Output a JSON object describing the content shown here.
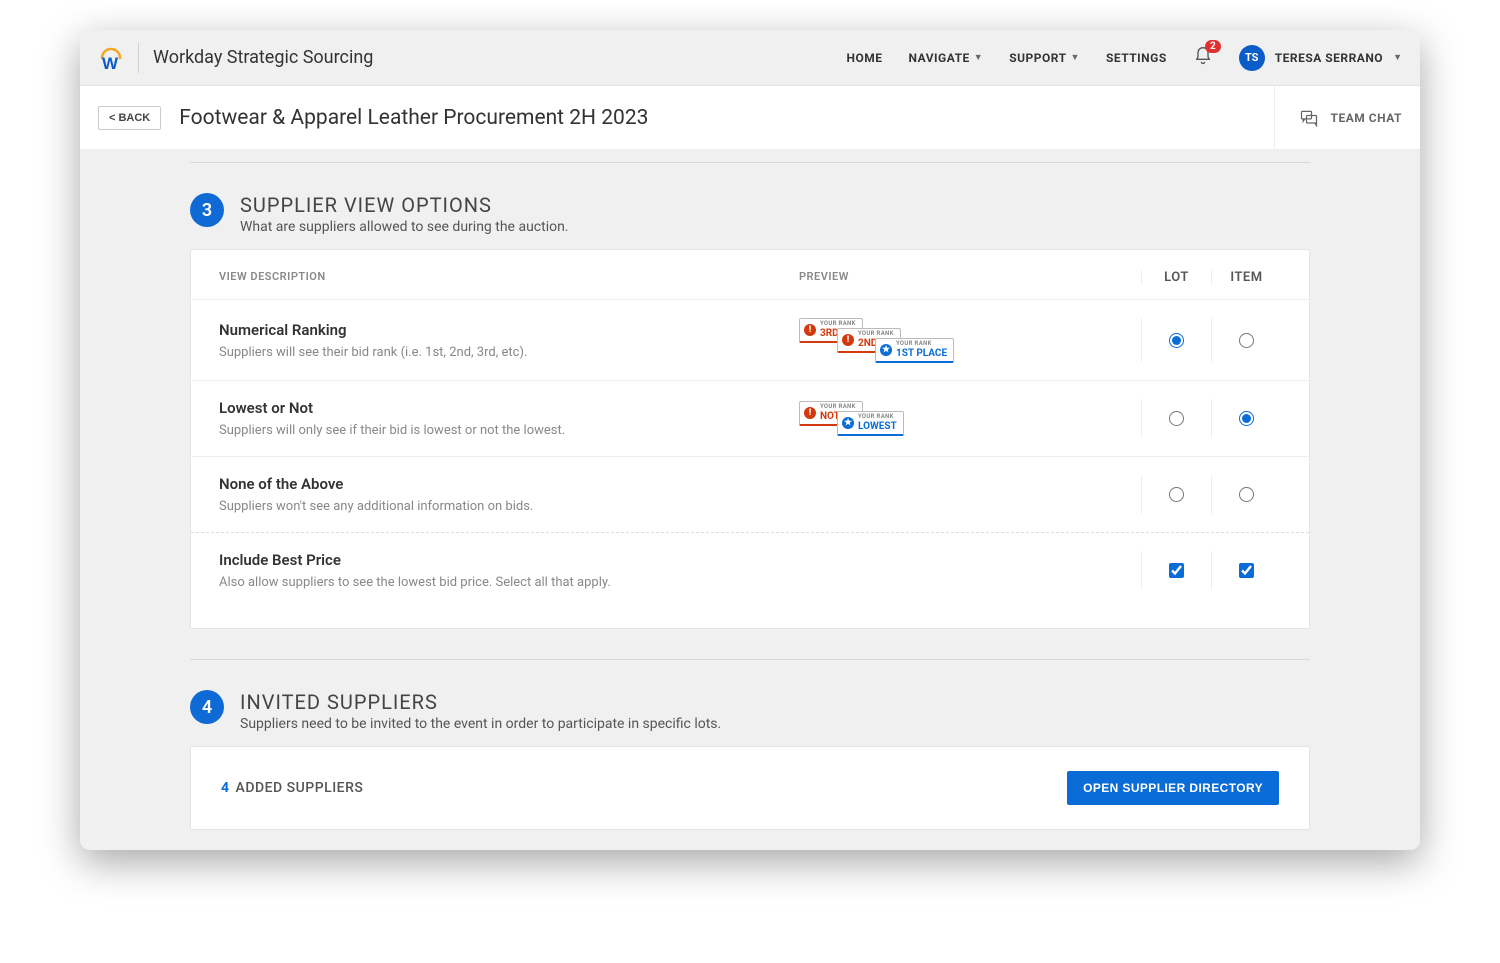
{
  "brand": "Workday Strategic Sourcing",
  "nav": {
    "home": "HOME",
    "navigate": "NAVIGATE",
    "support": "SUPPORT",
    "settings": "SETTINGS",
    "badge": "2",
    "avatar_initials": "TS",
    "user_name": "TERESA SERRANO"
  },
  "subheader": {
    "back": "< BACK",
    "title": "Footwear & Apparel Leather Procurement 2H 2023",
    "teamchat": "TEAM CHAT"
  },
  "section3": {
    "num": "3",
    "title": "SUPPLIER VIEW OPTIONS",
    "subtitle": "What are suppliers allowed to see during the auction.",
    "headers": {
      "desc": "VIEW DESCRIPTION",
      "preview": "PREVIEW",
      "lot": "LOT",
      "item": "ITEM"
    },
    "rows": [
      {
        "title": "Numerical Ranking",
        "desc": "Suppliers will see their bid rank (i.e. 1st, 2nd, 3rd, etc).",
        "lot_checked": true,
        "item_checked": false
      },
      {
        "title": "Lowest or Not",
        "desc": "Suppliers will only see if their bid is lowest or not the lowest.",
        "lot_checked": false,
        "item_checked": true
      },
      {
        "title": "None of the Above",
        "desc": "Suppliers won't see any additional information on bids.",
        "lot_checked": false,
        "item_checked": false
      },
      {
        "title": "Include Best Price",
        "desc": "Also allow suppliers to see the lowest bid price. Select all that apply.",
        "lot_checked": true,
        "item_checked": true
      }
    ],
    "preview_labels": {
      "your_rank": "YOUR RANK",
      "third": "3RD",
      "second": "2ND",
      "first": "1ST PLACE",
      "not": "NOT",
      "lowest": "LOWEST"
    }
  },
  "section4": {
    "num": "4",
    "title": "INVITED SUPPLIERS",
    "subtitle": "Suppliers need to be invited to the event in order to participate in specific lots.",
    "added_count": "4",
    "added_label": "ADDED SUPPLIERS",
    "open_dir": "OPEN SUPPLIER DIRECTORY"
  }
}
